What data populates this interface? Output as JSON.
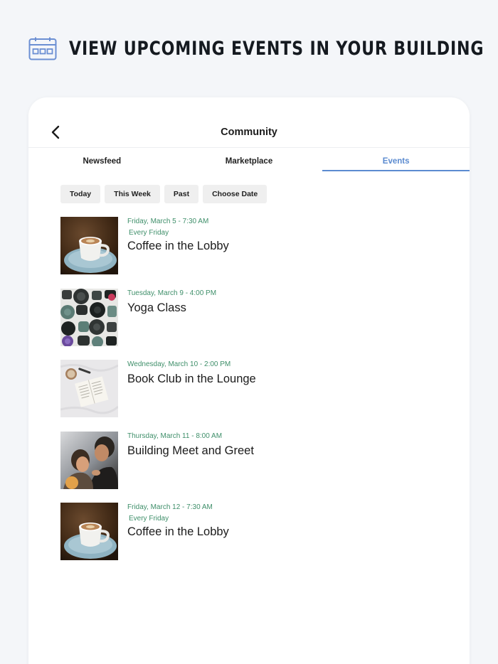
{
  "promo": {
    "headline": "VIEW UPCOMING EVENTS IN YOUR BUILDING",
    "icon": "calendar-icon"
  },
  "header": {
    "title": "Community",
    "back_icon": "chevron-left-icon"
  },
  "tabs": [
    {
      "label": "Newsfeed",
      "active": false
    },
    {
      "label": "Marketplace",
      "active": false
    },
    {
      "label": "Events",
      "active": true
    }
  ],
  "filters": [
    "Today",
    "This Week",
    "Past",
    "Choose Date"
  ],
  "events": [
    {
      "date": "Friday, March 5 - 7:30 AM",
      "recurrence": "Every Friday",
      "title": "Coffee in the Lobby",
      "image": "coffee"
    },
    {
      "date": "Tuesday, March 9 - 4:00 PM",
      "recurrence": "",
      "title": "Yoga Class",
      "image": "yoga"
    },
    {
      "date": "Wednesday, March 10 - 2:00 PM",
      "recurrence": "",
      "title": "Book Club in the Lounge",
      "image": "book"
    },
    {
      "date": "Thursday, March 11 - 8:00 AM",
      "recurrence": "",
      "title": "Building Meet and Greet",
      "image": "people"
    },
    {
      "date": "Friday, March 12 - 7:30 AM",
      "recurrence": "Every Friday",
      "title": "Coffee in the Lobby",
      "image": "coffee"
    }
  ],
  "colors": {
    "accent": "#5b8bd0",
    "date_text": "#3f8f6a",
    "background": "#f4f6f9"
  }
}
